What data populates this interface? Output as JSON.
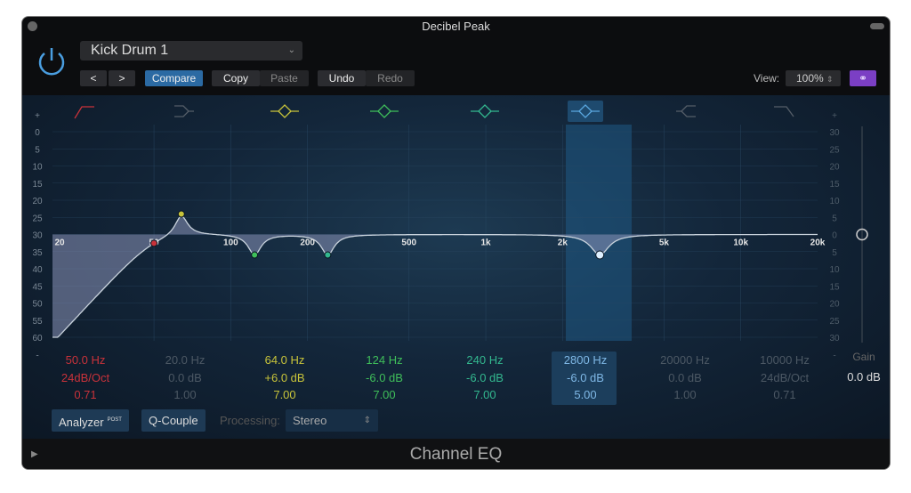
{
  "window": {
    "title": "Decibel Peak"
  },
  "header": {
    "preset": "Kick Drum 1",
    "prev": "<",
    "next": ">",
    "compare": "Compare",
    "copy": "Copy",
    "paste": "Paste",
    "undo": "Undo",
    "redo": "Redo",
    "view_label": "View:",
    "view_value": "100%"
  },
  "graph": {
    "left_scale": [
      "+",
      "0",
      "5",
      "10",
      "15",
      "20",
      "25",
      "30",
      "35",
      "40",
      "45",
      "50",
      "55",
      "60",
      "-"
    ],
    "right_scale": [
      "+",
      "30",
      "25",
      "20",
      "15",
      "10",
      "5",
      "0",
      "5",
      "10",
      "15",
      "20",
      "25",
      "30",
      "-"
    ],
    "freq_labels": [
      [
        "20",
        20
      ],
      [
        "50",
        50
      ],
      [
        "100",
        100
      ],
      [
        "200",
        200
      ],
      [
        "500",
        500
      ],
      [
        "1k",
        1000
      ],
      [
        "2k",
        2000
      ],
      [
        "5k",
        5000
      ],
      [
        "10k",
        10000
      ],
      [
        "20k",
        20000
      ]
    ],
    "selected_band": 5
  },
  "bands": [
    {
      "type": "low-cut",
      "icon": "low-cut-icon",
      "freq": "50.0 Hz",
      "gain": "24dB/Oct",
      "q": "0.71",
      "f": 50,
      "slope": 24,
      "enabled": true,
      "color": "#c9323a"
    },
    {
      "type": "low-shelf",
      "icon": "low-shelf-icon",
      "freq": "20.0 Hz",
      "gain": "0.0 dB",
      "q": "1.00",
      "f": 20,
      "g": 0,
      "enabled": false,
      "color": "#555e68"
    },
    {
      "type": "peak",
      "icon": "bell-icon",
      "freq": "64.0 Hz",
      "gain": "+6.0 dB",
      "q": "7.00",
      "f": 64,
      "g": 6,
      "Q": 7,
      "enabled": true,
      "color": "#c8c43a"
    },
    {
      "type": "peak",
      "icon": "bell-icon",
      "freq": "124 Hz",
      "gain": "-6.0 dB",
      "q": "7.00",
      "f": 124,
      "g": -6,
      "Q": 7,
      "enabled": true,
      "color": "#3fbf5a"
    },
    {
      "type": "peak",
      "icon": "bell-icon",
      "freq": "240 Hz",
      "gain": "-6.0 dB",
      "q": "7.00",
      "f": 240,
      "g": -6,
      "Q": 7,
      "enabled": true,
      "color": "#33b88f"
    },
    {
      "type": "peak",
      "icon": "bell-icon",
      "freq": "2800 Hz",
      "gain": "-6.0 dB",
      "q": "5.00",
      "f": 2800,
      "g": -6,
      "Q": 5,
      "enabled": true,
      "color": "#5aa8e0"
    },
    {
      "type": "high-shelf",
      "icon": "high-shelf-icon",
      "freq": "20000 Hz",
      "gain": "0.0 dB",
      "q": "1.00",
      "f": 20000,
      "g": 0,
      "enabled": false,
      "color": "#555e68"
    },
    {
      "type": "high-cut",
      "icon": "high-cut-icon",
      "freq": "10000 Hz",
      "gain": "24dB/Oct",
      "q": "0.71",
      "f": 10000,
      "enabled": false,
      "color": "#555e68"
    }
  ],
  "gain": {
    "label": "Gain",
    "value": "0.0 dB"
  },
  "controls": {
    "analyzer": "Analyzer",
    "analyzer_badge": "POST",
    "q_couple": "Q-Couple",
    "processing_label": "Processing:",
    "processing_value": "Stereo"
  },
  "footer": {
    "title": "Channel EQ"
  }
}
